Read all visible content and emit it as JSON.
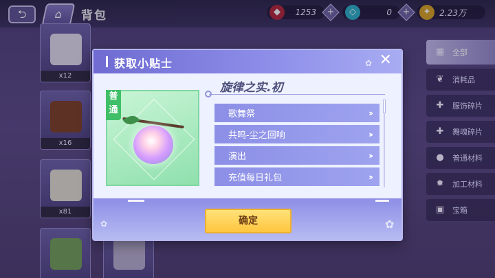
{
  "topbar": {
    "page_title": "背包",
    "currencies": [
      {
        "icon": "red-gem-icon",
        "value": "1253"
      },
      {
        "icon": "diamond-icon",
        "value": "0"
      },
      {
        "icon": "gold-butterfly-icon",
        "value": "2.23万"
      }
    ]
  },
  "inventory": {
    "slots": [
      {
        "qty": "x12"
      },
      {
        "qty": "x16"
      },
      {
        "qty": "x81"
      },
      {
        "qty": ""
      }
    ]
  },
  "sidebar": {
    "items": [
      {
        "label": "全部"
      },
      {
        "label": "消耗品"
      },
      {
        "label": "服饰碎片"
      },
      {
        "label": "舞魂碎片"
      },
      {
        "label": "普通材料"
      },
      {
        "label": "加工材料"
      },
      {
        "label": "宝箱"
      }
    ]
  },
  "dialog": {
    "title": "获取小贴士",
    "rarity": "普通",
    "item_name": "旋律之实.初",
    "sources": [
      {
        "label": "歌舞祭"
      },
      {
        "label": "共鸣-尘之回响"
      },
      {
        "label": "演出"
      },
      {
        "label": "充值每日礼包"
      }
    ],
    "confirm_label": "确定"
  },
  "colors": {
    "header": "#7b79dc",
    "source_button": "#959aec",
    "confirm": "#ffd35a",
    "rarity_green": "#3fbf67"
  }
}
